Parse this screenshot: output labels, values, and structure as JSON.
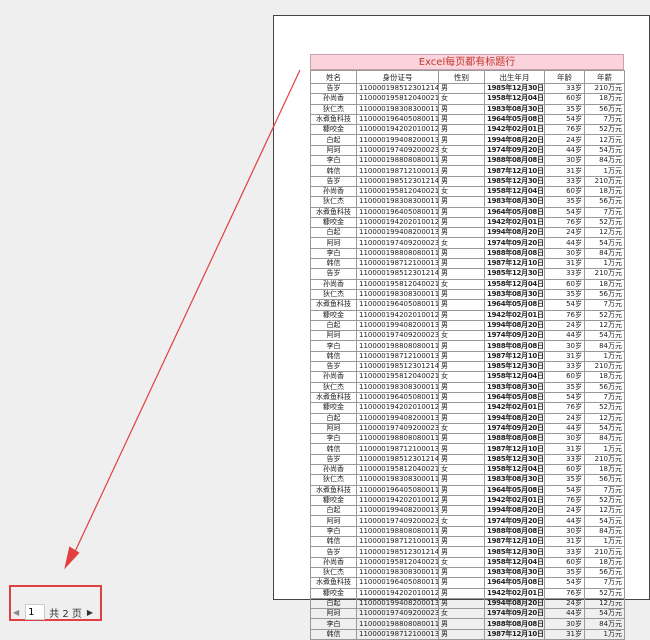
{
  "sheet": {
    "title": "Excel每页都有标题行",
    "headers": [
      "姓名",
      "身份证号",
      "性别",
      "出生年月",
      "年龄",
      "年薪"
    ],
    "rows": [
      [
        "告岁",
        "110000198512301214",
        "男",
        "1985年12月30日",
        "33岁",
        "210万元"
      ],
      [
        "孙尚香",
        "110000195812040021",
        "女",
        "1958年12月04日",
        "60岁",
        "18万元"
      ],
      [
        "狄仁杰",
        "110000198308300011",
        "男",
        "1983年08月30日",
        "35岁",
        "56万元"
      ],
      [
        "水煮鱼科技",
        "110000196405080011",
        "男",
        "1964年05月08日",
        "54岁",
        "7万元"
      ],
      [
        "糠咬金",
        "110000194202010012",
        "男",
        "1942年02月01日",
        "76岁",
        "52万元"
      ],
      [
        "白起",
        "110000199408200013",
        "男",
        "1994年08月20日",
        "24岁",
        "12万元"
      ],
      [
        "阿珂",
        "110000197409200023",
        "女",
        "1974年09月20日",
        "44岁",
        "54万元"
      ],
      [
        "李白",
        "110000198808080011",
        "男",
        "1988年08月08日",
        "30岁",
        "84万元"
      ],
      [
        "韩信",
        "110000198712100013",
        "男",
        "1987年12月10日",
        "31岁",
        "1万元"
      ],
      [
        "告岁",
        "110000198512301214",
        "男",
        "1985年12月30日",
        "33岁",
        "210万元"
      ],
      [
        "孙尚香",
        "110000195812040021",
        "女",
        "1958年12月04日",
        "60岁",
        "18万元"
      ],
      [
        "狄仁杰",
        "110000198308300011",
        "男",
        "1983年08月30日",
        "35岁",
        "56万元"
      ],
      [
        "水煮鱼科技",
        "110000196405080011",
        "男",
        "1964年05月08日",
        "54岁",
        "7万元"
      ],
      [
        "糠咬金",
        "110000194202010012",
        "男",
        "1942年02月01日",
        "76岁",
        "52万元"
      ],
      [
        "白起",
        "110000199408200013",
        "男",
        "1994年08月20日",
        "24岁",
        "12万元"
      ],
      [
        "阿珂",
        "110000197409200023",
        "女",
        "1974年09月20日",
        "44岁",
        "54万元"
      ],
      [
        "李白",
        "110000198808080011",
        "男",
        "1988年08月08日",
        "30岁",
        "84万元"
      ],
      [
        "韩信",
        "110000198712100013",
        "男",
        "1987年12月10日",
        "31岁",
        "1万元"
      ],
      [
        "告岁",
        "110000198512301214",
        "男",
        "1985年12月30日",
        "33岁",
        "210万元"
      ],
      [
        "孙尚香",
        "110000195812040021",
        "女",
        "1958年12月04日",
        "60岁",
        "18万元"
      ],
      [
        "狄仁杰",
        "110000198308300011",
        "男",
        "1983年08月30日",
        "35岁",
        "56万元"
      ],
      [
        "水煮鱼科技",
        "110000196405080011",
        "男",
        "1964年05月08日",
        "54岁",
        "7万元"
      ],
      [
        "糠咬金",
        "110000194202010012",
        "男",
        "1942年02月01日",
        "76岁",
        "52万元"
      ],
      [
        "白起",
        "110000199408200013",
        "男",
        "1994年08月20日",
        "24岁",
        "12万元"
      ],
      [
        "阿珂",
        "110000197409200023",
        "女",
        "1974年09月20日",
        "44岁",
        "54万元"
      ],
      [
        "李白",
        "110000198808080011",
        "男",
        "1988年08月08日",
        "30岁",
        "84万元"
      ],
      [
        "韩信",
        "110000198712100013",
        "男",
        "1987年12月10日",
        "31岁",
        "1万元"
      ],
      [
        "告岁",
        "110000198512301214",
        "男",
        "1985年12月30日",
        "33岁",
        "210万元"
      ],
      [
        "孙尚香",
        "110000195812040021",
        "女",
        "1958年12月04日",
        "60岁",
        "18万元"
      ],
      [
        "狄仁杰",
        "110000198308300011",
        "男",
        "1983年08月30日",
        "35岁",
        "56万元"
      ],
      [
        "水煮鱼科技",
        "110000196405080011",
        "男",
        "1964年05月08日",
        "54岁",
        "7万元"
      ],
      [
        "糠咬金",
        "110000194202010012",
        "男",
        "1942年02月01日",
        "76岁",
        "52万元"
      ],
      [
        "白起",
        "110000199408200013",
        "男",
        "1994年08月20日",
        "24岁",
        "12万元"
      ],
      [
        "阿珂",
        "110000197409200023",
        "女",
        "1974年09月20日",
        "44岁",
        "54万元"
      ],
      [
        "李白",
        "110000198808080011",
        "男",
        "1988年08月08日",
        "30岁",
        "84万元"
      ],
      [
        "韩信",
        "110000198712100013",
        "男",
        "1987年12月10日",
        "31岁",
        "1万元"
      ],
      [
        "告岁",
        "110000198512301214",
        "男",
        "1985年12月30日",
        "33岁",
        "210万元"
      ],
      [
        "孙尚香",
        "110000195812040021",
        "女",
        "1958年12月04日",
        "60岁",
        "18万元"
      ],
      [
        "狄仁杰",
        "110000198308300011",
        "男",
        "1983年08月30日",
        "35岁",
        "56万元"
      ],
      [
        "水煮鱼科技",
        "110000196405080011",
        "男",
        "1964年05月08日",
        "54岁",
        "7万元"
      ],
      [
        "糠咬金",
        "110000194202010012",
        "男",
        "1942年02月01日",
        "76岁",
        "52万元"
      ],
      [
        "白起",
        "110000199408200013",
        "男",
        "1994年08月20日",
        "24岁",
        "12万元"
      ],
      [
        "阿珂",
        "110000197409200023",
        "女",
        "1974年09月20日",
        "44岁",
        "54万元"
      ],
      [
        "李白",
        "110000198808080011",
        "男",
        "1988年08月08日",
        "30岁",
        "84万元"
      ],
      [
        "韩信",
        "110000198712100013",
        "男",
        "1987年12月10日",
        "31岁",
        "1万元"
      ],
      [
        "告岁",
        "110000198512301214",
        "男",
        "1985年12月30日",
        "33岁",
        "210万元"
      ],
      [
        "孙尚香",
        "110000195812040021",
        "女",
        "1958年12月04日",
        "60岁",
        "18万元"
      ],
      [
        "狄仁杰",
        "110000198308300011",
        "男",
        "1983年08月30日",
        "35岁",
        "56万元"
      ],
      [
        "水煮鱼科技",
        "110000196405080011",
        "男",
        "1964年05月08日",
        "54岁",
        "7万元"
      ],
      [
        "糠咬金",
        "110000194202010012",
        "男",
        "1942年02月01日",
        "76岁",
        "52万元"
      ],
      [
        "白起",
        "110000199408200013",
        "男",
        "1994年08月20日",
        "24岁",
        "12万元"
      ],
      [
        "阿珂",
        "110000197409200023",
        "女",
        "1974年09月20日",
        "44岁",
        "54万元"
      ],
      [
        "李白",
        "110000198808080011",
        "男",
        "1988年08月08日",
        "30岁",
        "84万元"
      ],
      [
        "韩信",
        "110000198712100013",
        "男",
        "1987年12月10日",
        "31岁",
        "1万元"
      ]
    ]
  },
  "pager": {
    "current_page": "1",
    "total_label": "共 2 页",
    "prev_icon": "triangle-left-icon",
    "next_icon": "triangle-right-icon"
  },
  "colors": {
    "title_bg": "#fbd3dc",
    "title_text": "#c0392b",
    "highlight": "#e04040"
  }
}
